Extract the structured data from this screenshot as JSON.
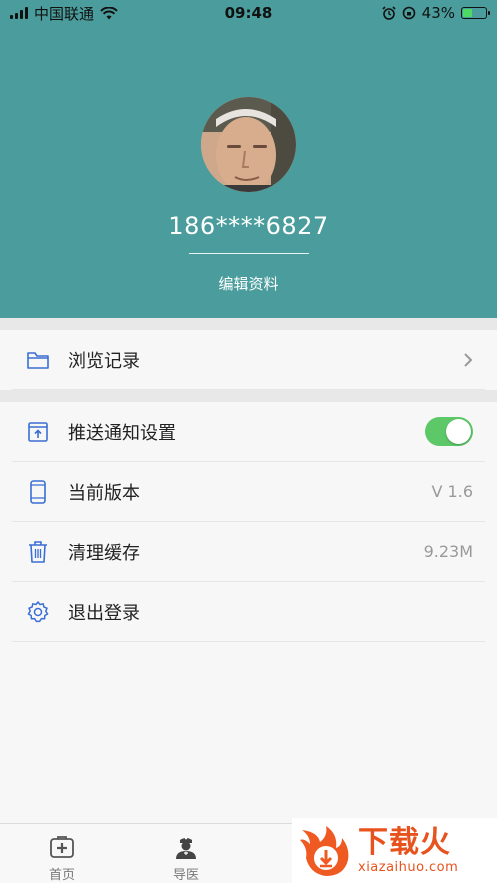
{
  "status_bar": {
    "carrier": "中国联通",
    "time": "09:48",
    "battery": "43%",
    "battery_level": 0.43
  },
  "profile": {
    "phone": "186****6827",
    "edit_label": "编辑资料"
  },
  "menu": {
    "history": {
      "label": "浏览记录",
      "icon": "folder-icon"
    },
    "push": {
      "label": "推送通知设置",
      "icon": "upload-box-icon",
      "enabled": true
    },
    "version": {
      "label": "当前版本",
      "value": "V 1.6",
      "icon": "phone-icon"
    },
    "cache": {
      "label": "清理缓存",
      "value": "9.23M",
      "icon": "trash-icon"
    },
    "logout": {
      "label": "退出登录",
      "icon": "gear-icon"
    }
  },
  "tabbar": {
    "tabs": [
      {
        "label": "首页",
        "icon": "medical-kit-icon"
      },
      {
        "label": "导医",
        "icon": "nurse-icon"
      }
    ]
  },
  "watermark": {
    "title": "下载火",
    "subtitle": "xiazaihuo.com"
  },
  "colors": {
    "header": "#4a9d9c",
    "icon_blue": "#3b6fd4",
    "toggle_on": "#5cc868",
    "watermark": "#e8521d"
  }
}
